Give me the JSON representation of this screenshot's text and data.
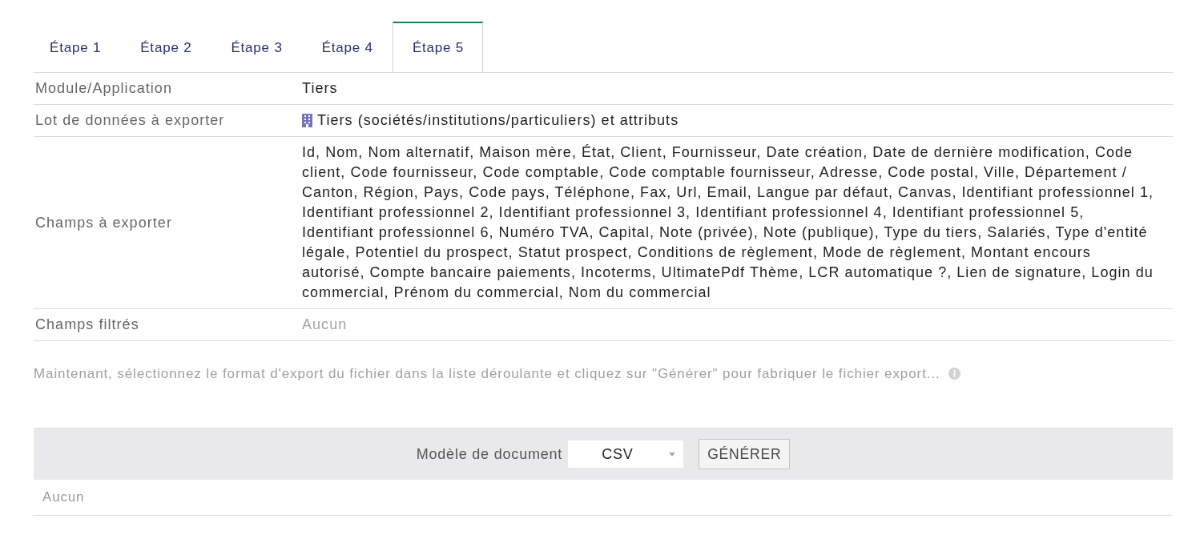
{
  "tabs": [
    {
      "label": "Étape 1",
      "selected": false
    },
    {
      "label": "Étape 2",
      "selected": false
    },
    {
      "label": "Étape 3",
      "selected": false
    },
    {
      "label": "Étape 4",
      "selected": false
    },
    {
      "label": "Étape 5",
      "selected": true
    }
  ],
  "summary": {
    "rows": [
      {
        "label": "Module/Application",
        "kind": "text",
        "value": "Tiers"
      },
      {
        "label": "Lot de données à exporter",
        "kind": "dataset",
        "value": "Tiers (sociétés/institutions/particuliers) et attributs"
      },
      {
        "label": "Champs à exporter",
        "kind": "text",
        "value": "Id, Nom, Nom alternatif, Maison mère, État, Client, Fournisseur, Date création, Date de dernière modification, Code client, Code fournisseur, Code comptable, Code comptable fournisseur, Adresse, Code postal, Ville, Département / Canton, Région, Pays, Code pays, Téléphone, Fax, Url, Email, Langue par défaut, Canvas, Identifiant professionnel 1, Identifiant professionnel 2, Identifiant professionnel 3, Identifiant professionnel 4, Identifiant professionnel 5, Identifiant professionnel 6, Numéro TVA, Capital, Note (privée), Note (publique), Type du tiers, Salariés, Type d'entité légale, Potentiel du prospect, Statut prospect, Conditions de règlement, Mode de règlement, Montant encours autorisé, Compte bancaire paiements, Incoterms, UltimatePdf Thème, LCR automatique ?, Lien de signature, Login du commercial, Prénom du commercial, Nom du commercial"
      },
      {
        "label": "Champs filtrés",
        "kind": "none",
        "value": "Aucun"
      }
    ]
  },
  "hint": {
    "text": "Maintenant, sélectionnez le format d'export du fichier dans la liste déroulante et cliquez sur \"Générer\" pour fabriquer le fichier export..."
  },
  "generate_bar": {
    "label": "Modèle de document",
    "format": "CSV",
    "button": "GÉNÉRER"
  },
  "files": {
    "empty_text": "Aucun"
  }
}
